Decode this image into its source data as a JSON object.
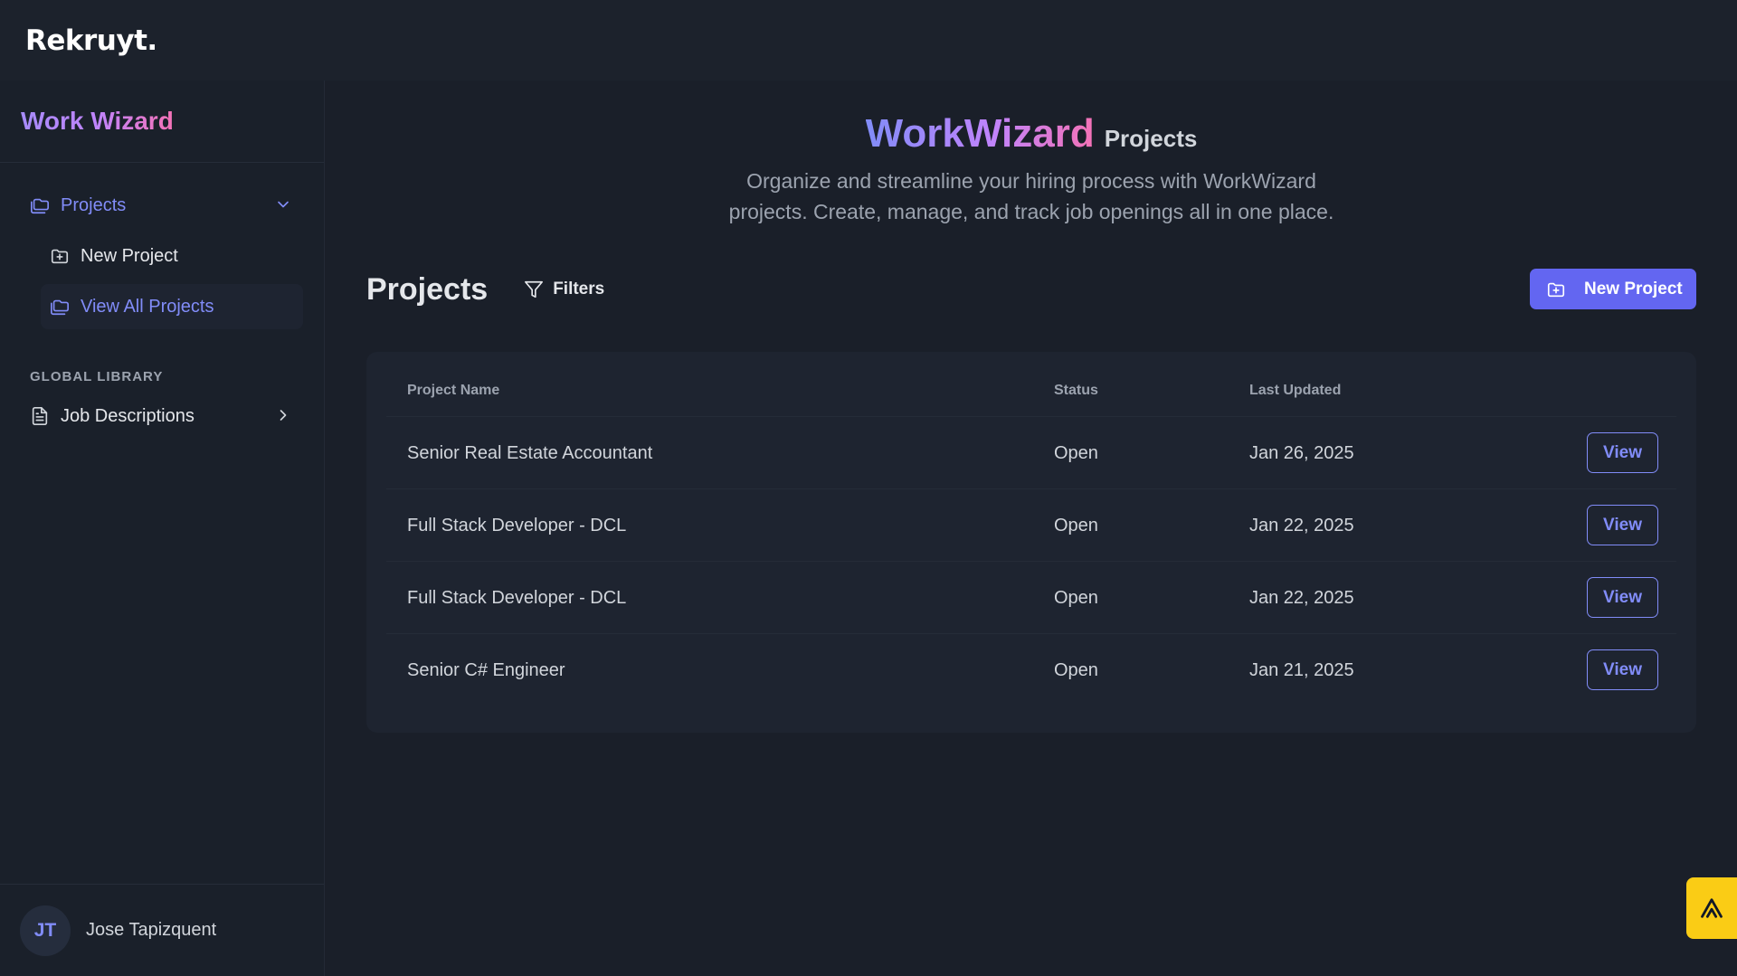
{
  "app": {
    "logo": "Rekruyt."
  },
  "sidebar": {
    "brand": "Work Wizard",
    "projects_label": "Projects",
    "new_project_label": "New Project",
    "view_all_label": "View All Projects",
    "section_label": "GLOBAL LIBRARY",
    "job_descriptions_label": "Job Descriptions",
    "user": {
      "initials": "JT",
      "name": "Jose Tapizquent"
    }
  },
  "hero": {
    "brand": "WorkWizard",
    "subtitle": "Projects",
    "description": "Organize and streamline your hiring process with WorkWizard projects. Create, manage, and track job openings all in one place."
  },
  "toolbar": {
    "title": "Projects",
    "filters_label": "Filters",
    "new_project_label": "New Project"
  },
  "table": {
    "headers": {
      "name": "Project Name",
      "status": "Status",
      "updated": "Last Updated"
    },
    "rows": [
      {
        "name": "Senior Real Estate Accountant",
        "status": "Open",
        "updated": "Jan 26, 2025",
        "action": "View"
      },
      {
        "name": "Full Stack Developer - DCL",
        "status": "Open",
        "updated": "Jan 22, 2025",
        "action": "View"
      },
      {
        "name": "Full Stack Developer - DCL",
        "status": "Open",
        "updated": "Jan 22, 2025",
        "action": "View"
      },
      {
        "name": "Senior C# Engineer",
        "status": "Open",
        "updated": "Jan 21, 2025",
        "action": "View"
      }
    ]
  },
  "colors": {
    "accent": "#6366f1",
    "accent_text": "#818cf8",
    "fab": "#facc15"
  }
}
